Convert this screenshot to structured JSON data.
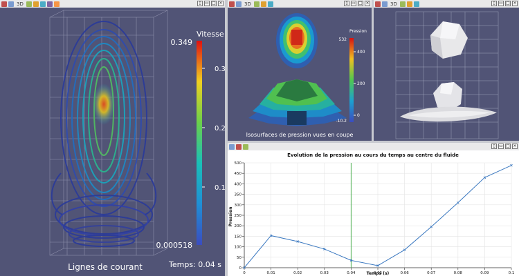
{
  "panes": {
    "streamlines": {
      "toolbar_3d": "3D",
      "caption": "Lignes de courant",
      "time_label": "Temps: 0.04 s",
      "legend": {
        "title": "Vitesse",
        "max": "0.349",
        "min": "0.000518",
        "ticks": [
          "0.3",
          "0.2",
          "0.1"
        ]
      }
    },
    "isosurfaces": {
      "toolbar_3d": "3D",
      "caption": "Isosurfaces de pression vues en coupe",
      "legend": {
        "title": "Pression",
        "max": "532",
        "min": "-10.2",
        "ticks": [
          "400",
          "200",
          "0"
        ]
      }
    },
    "surface_view": {
      "toolbar_3d": "3D"
    },
    "pressure_chart": {
      "title": "Evolution de la pression au cours du temps au centre du fluide"
    }
  },
  "chart_data": {
    "type": "line",
    "title": "Evolution de la pression au cours du temps au centre du fluide",
    "xlabel": "Temps (s)",
    "ylabel": "Pression",
    "xlim": [
      0,
      0.1
    ],
    "ylim": [
      0,
      500
    ],
    "x_ticks": [
      "0",
      "0.01",
      "0.02",
      "0.03",
      "0.04",
      "0.05",
      "0.06",
      "0.07",
      "0.08",
      "0.09",
      "0.1"
    ],
    "y_ticks": [
      "0",
      "50",
      "100",
      "150",
      "200",
      "250",
      "300",
      "350",
      "400",
      "450",
      "500"
    ],
    "grid": true,
    "current_time_marker": 0.04,
    "series": [
      {
        "color": "#3a78c0",
        "x": [
          0,
          0.01,
          0.02,
          0.03,
          0.04,
          0.05,
          0.06,
          0.07,
          0.08,
          0.09,
          0.1
        ],
        "y": [
          0,
          153,
          125,
          89,
          35,
          10,
          85,
          195,
          310,
          430,
          488
        ]
      }
    ],
    "marker_color": "#4caf50"
  },
  "colors": {
    "view_background": "#515476",
    "series_line": "#3a78c0",
    "time_marker": "#4caf50",
    "toolbar": "#e9e9ea"
  }
}
